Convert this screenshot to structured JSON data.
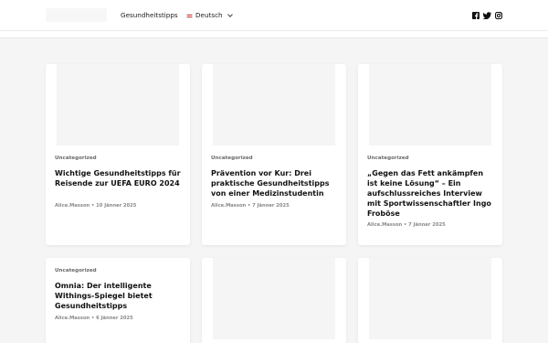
{
  "header": {
    "nav_label": "Gesundheitstipps",
    "language_label": "Deutsch",
    "social_icons": [
      "facebook-icon",
      "twitter-icon",
      "instagram-icon"
    ]
  },
  "posts": [
    {
      "category": "Uncategorized",
      "title": "Wichtige Gesundheitstipps für Reisende zur UEFA EURO 2024",
      "author": "Alice.Masson",
      "date": "10 Jänner 2025"
    },
    {
      "category": "Uncategorized",
      "title": "Prävention vor Kur: Drei praktische Gesundheitstipps von einer Medizinstudentin",
      "author": "Alice.Masson",
      "date": "7 Jänner 2025"
    },
    {
      "category": "Uncategorized",
      "title": "„Gegen das Fett ankämpfen ist keine Lösung“ – Ein aufschlussreiches Interview mit Sportwissenschaftler Ingo Froböse",
      "author": "Alice.Masson",
      "date": "7 Jänner 2025"
    },
    {
      "category": "Uncategorized",
      "title": "Omnia: Der intelligente Withings-Spiegel bietet Gesundheitstipps",
      "author": "Alice.Masson",
      "date": "6 Jänner 2025"
    }
  ]
}
